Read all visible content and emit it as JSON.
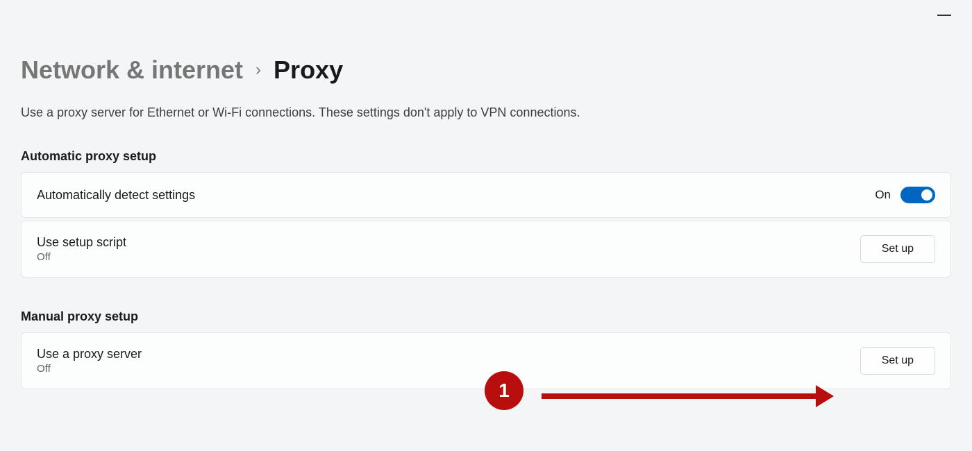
{
  "breadcrumb": {
    "parent": "Network & internet",
    "current": "Proxy"
  },
  "description": "Use a proxy server for Ethernet or Wi-Fi connections. These settings don't apply to VPN connections.",
  "sections": {
    "automatic": {
      "header": "Automatic proxy setup",
      "detect": {
        "title": "Automatically detect settings",
        "toggle_label": "On",
        "toggle_state": "on"
      },
      "script": {
        "title": "Use setup script",
        "subtitle": "Off",
        "button_label": "Set up"
      }
    },
    "manual": {
      "header": "Manual proxy setup",
      "server": {
        "title": "Use a proxy server",
        "subtitle": "Off",
        "button_label": "Set up"
      }
    }
  },
  "annotation": {
    "badge": "1"
  }
}
